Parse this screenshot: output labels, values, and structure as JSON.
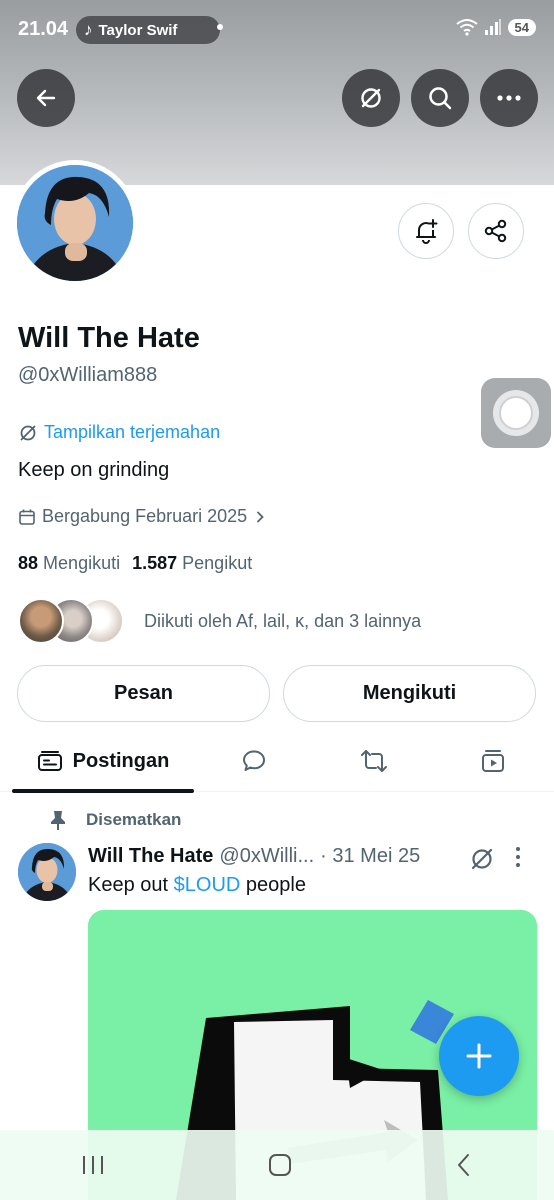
{
  "status_bar": {
    "time": "21.04",
    "music_title": "Taylor Swif",
    "battery": "54"
  },
  "profile": {
    "name": "Will The Hate",
    "handle": "@0xWilliam888",
    "translate_label": "Tampilkan terjemahan",
    "bio": "Keep on grinding",
    "joined": "Bergabung Februari 2025",
    "following_count": "88",
    "following_label": "Mengikuti",
    "followers_count": "1.587",
    "followers_label": "Pengikut",
    "followed_by": "Diikuti oleh Af, lail, κ, dan 3 lainnya"
  },
  "actions": {
    "message_label": "Pesan",
    "following_label": "Mengikuti"
  },
  "tabs": {
    "posts_label": "Postingan"
  },
  "post": {
    "pinned_label": "Disematkan",
    "author_name": "Will The Hate",
    "author_handle": "@0xWilli...",
    "date": "· 31 Mei 25",
    "text_before": "Keep out",
    "cashtag": "$LOUD",
    "text_after": "people"
  },
  "colors": {
    "accent": "#1d9bf0",
    "image_bg": "#79f0a5"
  },
  "icons": [
    "back-icon",
    "translate-icon",
    "search-icon",
    "more-icon",
    "bell-plus-icon",
    "share-icon",
    "calendar-icon",
    "chevron-right-icon",
    "posts-tab-icon",
    "reply-icon",
    "repost-icon",
    "media-icon",
    "pin-icon",
    "plus-icon",
    "recents-icon",
    "home-icon",
    "back-nav-icon"
  ]
}
